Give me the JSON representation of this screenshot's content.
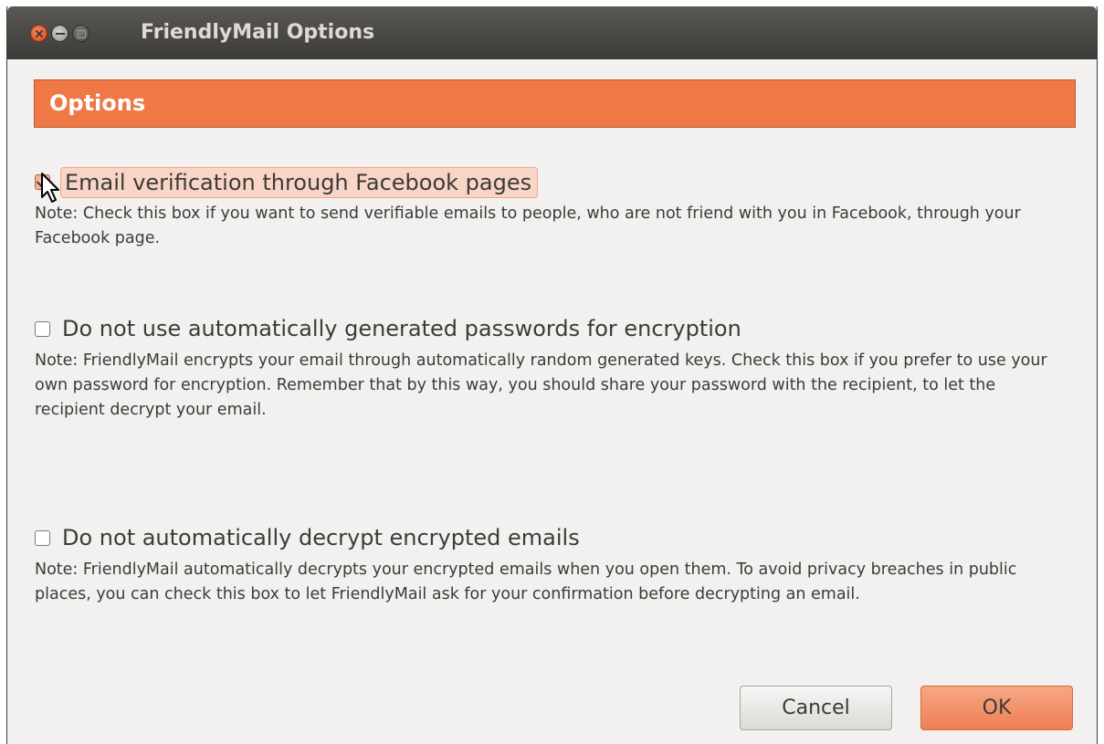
{
  "window": {
    "title": "FriendlyMail Options"
  },
  "header": {
    "title": "Options"
  },
  "options": [
    {
      "label": "Email verification through Facebook pages",
      "checked": true,
      "note": "Note: Check this box if you want to send verifiable emails to people, who are not friend with you in Facebook, through your Facebook page."
    },
    {
      "label": "Do not use automatically generated passwords for encryption",
      "checked": false,
      "note": "Note: FriendlyMail encrypts your email through automatically random generated keys. Check this box if you prefer to use your own password for encryption. Remember that by this way, you should share your password with the recipient, to let the recipient decrypt your email."
    },
    {
      "label": "Do not automatically decrypt encrypted emails",
      "checked": false,
      "note": "Note: FriendlyMail automatically decrypts your encrypted emails when you open them. To avoid privacy breaches in public places, you can check this box to let FriendlyMail ask for your confirmation before decrypting an email."
    }
  ],
  "buttons": {
    "cancel": "Cancel",
    "ok": "OK"
  },
  "colors": {
    "accent": "#f07746",
    "titlebar": "#3c3b37",
    "background": "#f2f1f0"
  },
  "icons": {
    "close": "close-icon",
    "minimize": "minimize-icon",
    "maximize": "maximize-icon",
    "cursor": "mouse-cursor-icon"
  }
}
